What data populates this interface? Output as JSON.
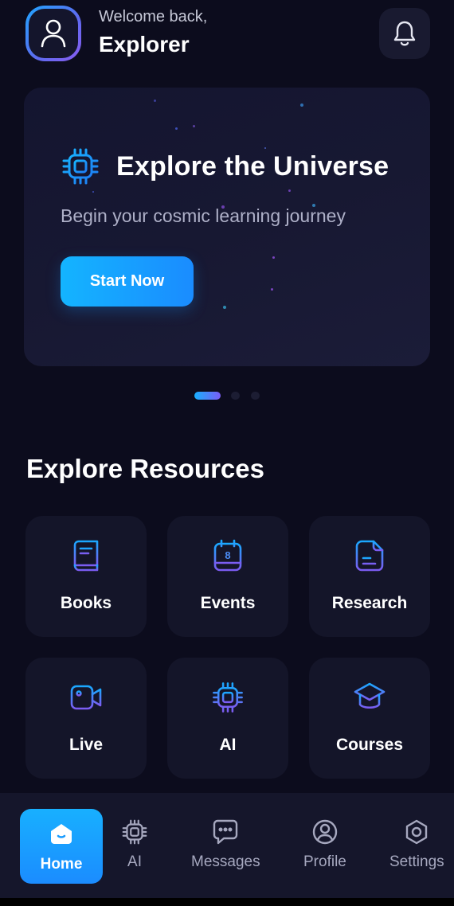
{
  "header": {
    "welcome_text": "Welcome back,",
    "username": "Explorer",
    "avatar_icon": "user-icon",
    "notification_icon": "bell-icon"
  },
  "hero": {
    "icon": "chip-icon",
    "title": "Explore the Universe",
    "subtitle": "Begin your cosmic learning journey",
    "button_label": "Start Now"
  },
  "carousel": {
    "total": 3,
    "active_index": 0
  },
  "resources": {
    "title": "Explore Resources",
    "items": [
      {
        "label": "Books",
        "icon": "book-icon"
      },
      {
        "label": "Events",
        "icon": "calendar-icon",
        "icon_text": "8"
      },
      {
        "label": "Research",
        "icon": "document-icon"
      },
      {
        "label": "Live",
        "icon": "video-camera-icon"
      },
      {
        "label": "AI",
        "icon": "chip-icon"
      },
      {
        "label": "Courses",
        "icon": "graduation-cap-icon"
      }
    ]
  },
  "nav": {
    "active": "Home",
    "items": [
      {
        "label": "Home",
        "icon": "home-icon"
      },
      {
        "label": "AI",
        "icon": "chip-icon"
      },
      {
        "label": "Messages",
        "icon": "message-icon"
      },
      {
        "label": "Profile",
        "icon": "profile-icon"
      },
      {
        "label": "Settings",
        "icon": "settings-icon"
      }
    ]
  },
  "colors": {
    "background": "#0c0c1d",
    "card": "#141529",
    "accent_blue": "#18b0ff",
    "accent_purple": "#8a5cf0"
  }
}
